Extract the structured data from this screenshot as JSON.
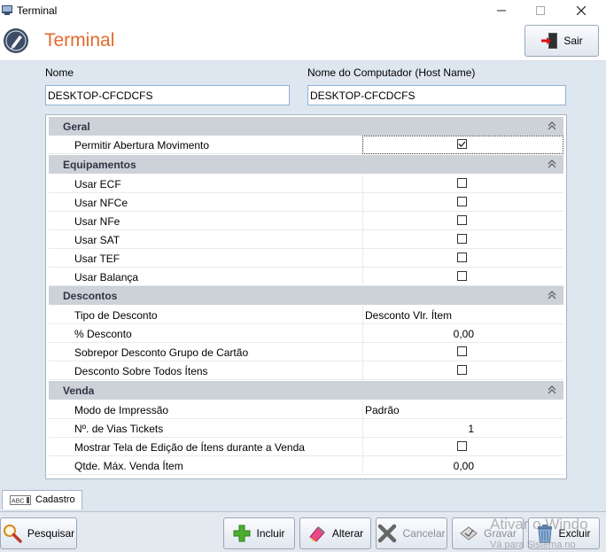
{
  "window": {
    "title": "Terminal",
    "minimize": "—",
    "maximize": "☐",
    "close": "✕"
  },
  "header": {
    "title": "Terminal",
    "exit_label": "Sair"
  },
  "form": {
    "name_label": "Nome",
    "name_value": "DESKTOP-CFCDCFS",
    "host_label": "Nome do Computador (Host Name)",
    "host_value": "DESKTOP-CFCDCFS"
  },
  "grid": {
    "categories": [
      {
        "name": "Geral",
        "rows": [
          {
            "label": "Permitir Abertura Movimento",
            "type": "checkbox",
            "checked": true
          }
        ]
      },
      {
        "name": "Equipamentos",
        "rows": [
          {
            "label": "Usar ECF",
            "type": "checkbox",
            "checked": false
          },
          {
            "label": "Usar NFCe",
            "type": "checkbox",
            "checked": false
          },
          {
            "label": "Usar NFe",
            "type": "checkbox",
            "checked": false
          },
          {
            "label": "Usar SAT",
            "type": "checkbox",
            "checked": false
          },
          {
            "label": "Usar TEF",
            "type": "checkbox",
            "checked": false
          },
          {
            "label": "Usar Balança",
            "type": "checkbox",
            "checked": false
          }
        ]
      },
      {
        "name": "Descontos",
        "rows": [
          {
            "label": "Tipo de Desconto",
            "type": "text",
            "value": "Desconto Vlr. Ítem"
          },
          {
            "label": "% Desconto",
            "type": "number",
            "value": "0,00"
          },
          {
            "label": "Sobrepor Desconto Grupo de Cartão",
            "type": "checkbox",
            "checked": false
          },
          {
            "label": "Desconto Sobre Todos Ítens",
            "type": "checkbox",
            "checked": false
          }
        ]
      },
      {
        "name": "Venda",
        "rows": [
          {
            "label": "Modo de Impressão",
            "type": "text",
            "value": "Padrão"
          },
          {
            "label": "Nº. de Vias Tickets",
            "type": "number",
            "value": "1"
          },
          {
            "label": "Mostrar Tela de Edição de Ítens durante a Venda",
            "type": "checkbox",
            "checked": false
          },
          {
            "label": "Qtde. Máx. Venda Ítem",
            "type": "number",
            "value": "0,00"
          }
        ]
      }
    ]
  },
  "tab": {
    "icon_text": "ABC",
    "label": "Cadastro"
  },
  "footer": {
    "search_label": "Pesquisar",
    "add_label": "Incluir",
    "edit_label": "Alterar",
    "cancel_label": "Cancelar",
    "save_label": "Gravar",
    "delete_label": "Excluir"
  },
  "watermark": {
    "line1": "Ativar o Windo",
    "line2": "Vá para Sistema no"
  },
  "colors": {
    "title_accent": "#e26a2c",
    "category_bg": "#cdd2d8",
    "input_border": "#8fb3d6"
  }
}
